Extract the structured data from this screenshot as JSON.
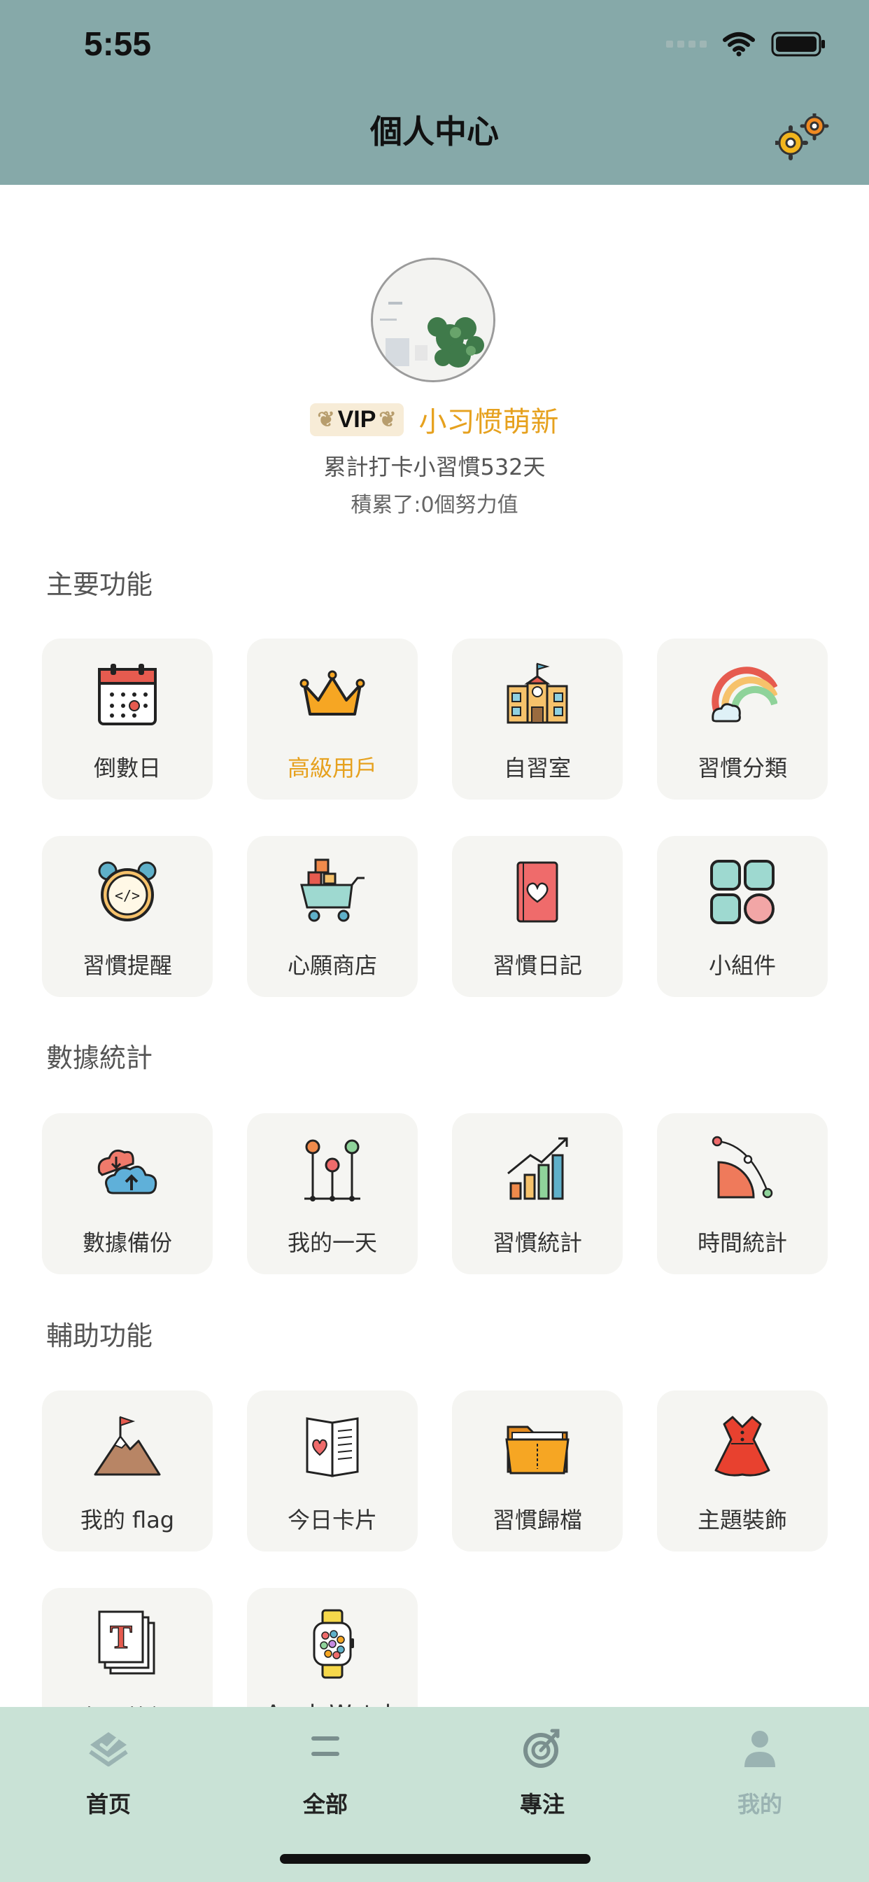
{
  "status": {
    "time": "5:55"
  },
  "header": {
    "title": "個人中心"
  },
  "profile": {
    "vip_label": "VIP",
    "username": "小习惯萌新",
    "checkin_text": "累計打卡小習慣532天",
    "effort_text": "積累了:0個努力值"
  },
  "sections": {
    "main": "主要功能",
    "stats": "數據統計",
    "aux": "輔助功能"
  },
  "main_items": [
    {
      "label": "倒數日",
      "icon": "calendar-icon"
    },
    {
      "label": "高級用戶",
      "icon": "crown-icon"
    },
    {
      "label": "自習室",
      "icon": "school-icon"
    },
    {
      "label": "習慣分類",
      "icon": "rainbow-icon"
    },
    {
      "label": "習慣提醒",
      "icon": "alarm-clock-icon"
    },
    {
      "label": "心願商店",
      "icon": "shopping-cart-icon"
    },
    {
      "label": "習慣日記",
      "icon": "heart-book-icon"
    },
    {
      "label": "小組件",
      "icon": "widgets-icon"
    }
  ],
  "stats_items": [
    {
      "label": "數據備份",
      "icon": "cloud-backup-icon"
    },
    {
      "label": "我的一天",
      "icon": "timeline-icon"
    },
    {
      "label": "習慣統計",
      "icon": "bar-chart-icon"
    },
    {
      "label": "時間統計",
      "icon": "pie-slice-icon"
    }
  ],
  "aux_items": [
    {
      "label": "我的 flag",
      "icon": "mountain-flag-icon"
    },
    {
      "label": "今日卡片",
      "icon": "card-icon"
    },
    {
      "label": "習慣歸檔",
      "icon": "folder-icon"
    },
    {
      "label": "主題裝飾",
      "icon": "dress-icon"
    },
    {
      "label": "每日簽記",
      "icon": "text-cards-icon"
    },
    {
      "label": "AppleWatch",
      "icon": "watch-icon"
    }
  ],
  "tabs": [
    {
      "label": "首页",
      "icon": "home-icon"
    },
    {
      "label": "全部",
      "icon": "list-icon"
    },
    {
      "label": "專注",
      "icon": "target-icon"
    },
    {
      "label": "我的",
      "icon": "person-icon"
    }
  ],
  "colors": {
    "header_bg": "#86a9a9",
    "tabbar_bg": "#c9e2d6",
    "accent_gold": "#e6a11e",
    "tile_bg": "#f5f5f2"
  }
}
